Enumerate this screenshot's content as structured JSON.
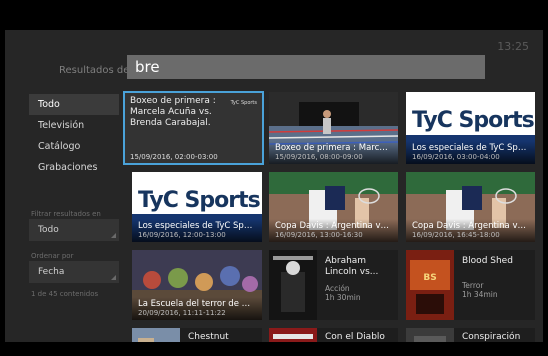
{
  "clock": "13:25",
  "search": {
    "label": "Resultados de",
    "value": "bre"
  },
  "sidebar": {
    "items": [
      {
        "label": "Todo"
      },
      {
        "label": "Televisión"
      },
      {
        "label": "Catálogo"
      },
      {
        "label": "Grabaciones"
      }
    ]
  },
  "filter": {
    "label": "Filtrar resultados en",
    "value": "Todo"
  },
  "order": {
    "label": "Ordenar por",
    "value": "Fecha"
  },
  "count": "1 de 45 contenidos",
  "results": [
    {
      "title": "Boxeo de primera : Marcela Acuña vs. Brenda Carabajal.",
      "date": "15/09/2016, 02:00-03:00",
      "logo": "TyC Sports"
    },
    {
      "title": "Boxeo de primera : Marcel...",
      "date": "15/09/2016, 08:00-09:00"
    },
    {
      "title": "Los especiales de TyC Spor...",
      "date": "16/09/2016, 03:00-04:00",
      "brand": "TyC Sports"
    },
    {
      "title": "Los especiales de TyC Spor...",
      "date": "16/09/2016, 12:00-13:00",
      "brand": "TyC Sports"
    },
    {
      "title": "Copa Davis : Argentina vs. ...",
      "date": "16/09/2016, 13:00-16:30"
    },
    {
      "title": "Copa Davis : Argentina vs. ...",
      "date": "16/09/2016, 16:45-18:00"
    },
    {
      "title": "La Escuela del terror de Ca...",
      "date": "20/09/2016, 11:11-11:22"
    },
    {
      "title": "Abraham Lincoln vs...",
      "genre": "Acción",
      "duration": "1h 30min"
    },
    {
      "title": "Blood Shed",
      "genre": "Terror",
      "duration": "1h 34min"
    },
    {
      "title": "Chestnut"
    },
    {
      "title": "Con el Diablo"
    },
    {
      "title": "Conspiración en"
    }
  ]
}
